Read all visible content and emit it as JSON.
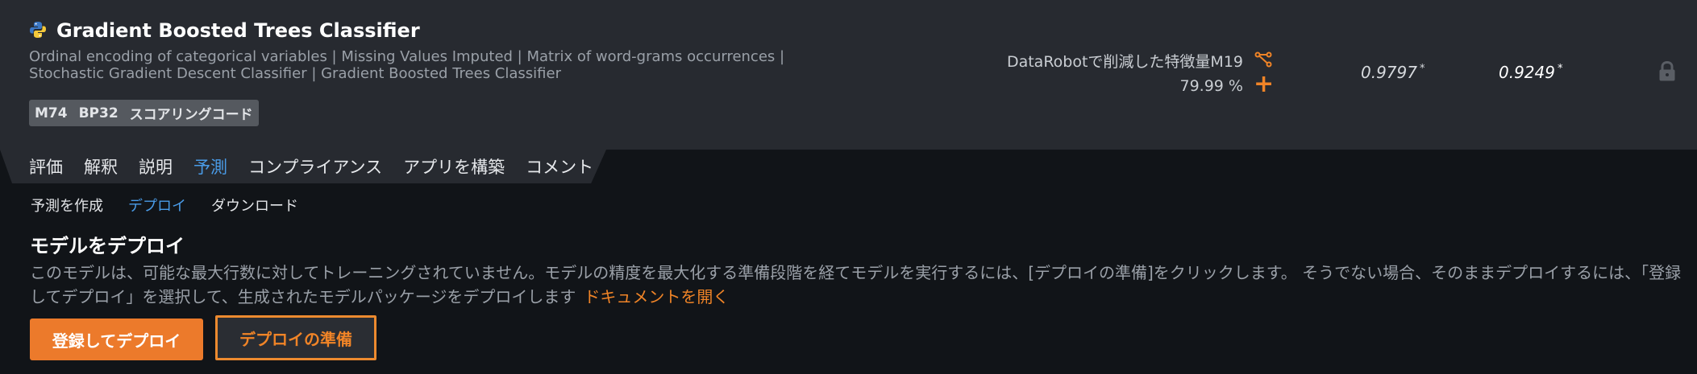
{
  "model": {
    "title": "Gradient Boosted Trees Classifier",
    "description": "Ordinal encoding of categorical variables | Missing Values Imputed | Matrix of word-grams occurrences | Stochastic Gradient Descent Classifier | Gradient Boosted Trees Classifier",
    "tags": [
      "M74",
      "BP32",
      "スコアリングコード"
    ],
    "feature_list": "DataRobotで削減した特徴量M19",
    "sample_pct": "79.99 %",
    "scores": [
      "0.9797",
      "0.9249"
    ],
    "score_marker": "*",
    "icons": {
      "language": "python-icon",
      "features": "feature-list-icon",
      "add": "plus-icon",
      "lock": "lock-icon"
    },
    "accent_color": "#f08427"
  },
  "tabs": [
    {
      "label": "評価",
      "active": false
    },
    {
      "label": "解釈",
      "active": false
    },
    {
      "label": "説明",
      "active": false
    },
    {
      "label": "予測",
      "active": true
    },
    {
      "label": "コンプライアンス",
      "active": false
    },
    {
      "label": "アプリを構築",
      "active": false
    },
    {
      "label": "コメント",
      "active": false
    }
  ],
  "subtabs": [
    {
      "label": "予測を作成",
      "active": false
    },
    {
      "label": "デプロイ",
      "active": true
    },
    {
      "label": "ダウンロード",
      "active": false
    }
  ],
  "deploy": {
    "title": "モデルをデプロイ",
    "description": "このモデルは、可能な最大行数に対してトレーニングされていません。モデルの精度を最大化する準備段階を経てモデルを実行するには、[デプロイの準備]をクリックします。 そうでない場合、そのままデプロイするには、「登録してデプロイ」を選択して、生成されたモデルパッケージをデプロイします",
    "doc_link": "ドキュメントを開く",
    "register_button": "登録してデプロイ",
    "prepare_button": "デプロイの準備"
  }
}
